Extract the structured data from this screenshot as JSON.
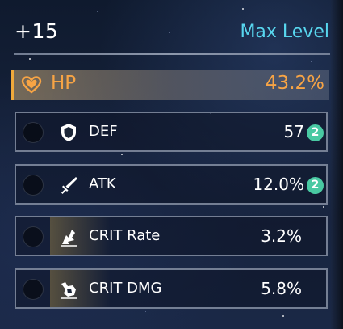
{
  "header": {
    "level_label": "+15",
    "max_level_label": "Max Level"
  },
  "main_stat": {
    "name": "HP",
    "value": "43.2%",
    "icon": "heart-icon",
    "color": "#f7a445"
  },
  "sub_stats": [
    {
      "name": "DEF",
      "value": "57",
      "roll_count": "2",
      "icon": "shield-icon"
    },
    {
      "name": "ATK",
      "value": "12.0%",
      "roll_count": "2",
      "icon": "sword-icon"
    },
    {
      "name": "CRIT Rate",
      "value": "3.2%",
      "icon": "crit-rate-icon"
    },
    {
      "name": "CRIT DMG",
      "value": "5.8%",
      "icon": "crit-dmg-icon"
    }
  ],
  "colors": {
    "accent": "#58d6ee",
    "main_stat": "#f7a445",
    "badge": "#49c9a2"
  }
}
